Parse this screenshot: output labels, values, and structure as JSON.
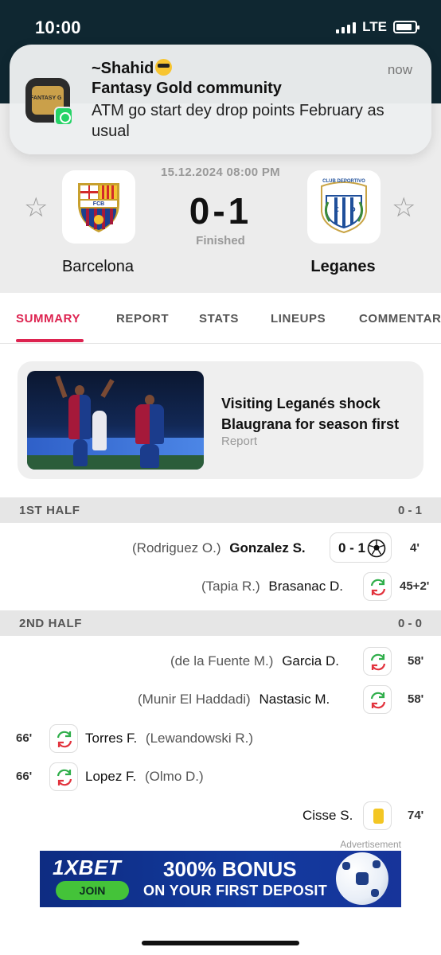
{
  "status_bar": {
    "time": "10:00",
    "network": "LTE"
  },
  "notification": {
    "sender": "~Shahid",
    "sender_emoji": "sunglasses-emoji",
    "group": "Fantasy Gold community",
    "message": "ATM go start dey drop points February as usual",
    "time": "now",
    "app_icon_text": "FANTASY G"
  },
  "match": {
    "datetime": "15.12.2024 08:00 PM",
    "score": "0-1",
    "status": "Finished",
    "home_team": "Barcelona",
    "away_team": "Leganes",
    "home_crest_text": "FCB",
    "away_crest_text": "CLUB DEPORTIVO"
  },
  "tabs": [
    {
      "label": "SUMMARY",
      "active": true
    },
    {
      "label": "REPORT",
      "active": false
    },
    {
      "label": "STATS",
      "active": false
    },
    {
      "label": "LINEUPS",
      "active": false
    },
    {
      "label": "COMMENTARY",
      "active": false
    }
  ],
  "article": {
    "title": "Visiting Leganés shock Blaugrana for season first",
    "type": "Report"
  },
  "first_half": {
    "label": "1ST HALF",
    "score": "0 - 1",
    "events": [
      {
        "assist": "(Rodriguez O.)",
        "player": "Gonzalez S.",
        "goal_score": "0 - 1",
        "icon": "soccer-ball-icon",
        "minute": "4'"
      },
      {
        "assist": "(Tapia R.)",
        "player": "Brasanac D.",
        "icon": "substitution-icon",
        "minute": "45+2'"
      }
    ]
  },
  "second_half": {
    "label": "2ND HALF",
    "score": "0 - 0",
    "events": [
      {
        "assist": "(de la Fuente M.)",
        "player": "Garcia D.",
        "icon": "substitution-icon",
        "minute": "58'"
      },
      {
        "assist": "(Munir El Haddadi)",
        "player": "Nastasic M.",
        "icon": "substitution-icon",
        "minute": "58'"
      },
      {
        "minute": "66'",
        "icon": "substitution-icon",
        "player": "Torres F.",
        "assist": "(Lewandowski R.)"
      },
      {
        "minute": "66'",
        "icon": "substitution-icon",
        "player": "Lopez F.",
        "assist": "(Olmo D.)"
      },
      {
        "player": "Cisse S.",
        "icon": "yellow-card-icon",
        "minute": "74'"
      }
    ]
  },
  "ad": {
    "label": "Advertisement",
    "brand": "1XBET",
    "join": "JOIN",
    "headline": "300% BONUS",
    "subline": "ON YOUR FIRST DEPOSIT"
  },
  "colors": {
    "header_bg": "#0f2731",
    "accent": "#dd2350",
    "sub_in": "#2fae4a",
    "sub_out": "#e2333d",
    "yellow_card": "#f3c623"
  }
}
